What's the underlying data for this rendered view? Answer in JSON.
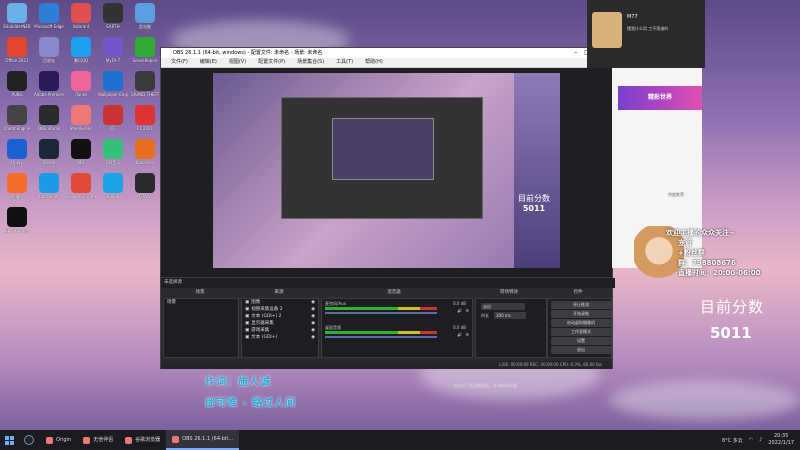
{
  "desktop": {
    "icons": [
      {
        "label": "EdubilderNEB",
        "color": "#6ab0e8"
      },
      {
        "label": "Microsoft Edge",
        "color": "#2f7fd8"
      },
      {
        "label": "Valorant",
        "color": "#e05050"
      },
      {
        "label": "EARTH",
        "color": "#333"
      },
      {
        "label": "此电脑",
        "color": "#5aa0e0"
      },
      {
        "label": "Office 2021",
        "color": "#e4452f"
      },
      {
        "label": "回收站",
        "color": "#88c"
      },
      {
        "label": "腾讯QQ",
        "color": "#1ea0f0"
      },
      {
        "label": "MyFA-7",
        "color": "#7755cc"
      },
      {
        "label": "SenseRepair",
        "color": "#3a3"
      },
      {
        "label": "PUBG",
        "color": "#222"
      },
      {
        "label": "Adobe Premiere",
        "color": "#2a1a55"
      },
      {
        "label": "iTunes",
        "color": "#ee6699"
      },
      {
        "label": "Wallpaper Engine",
        "color": "#2070d0"
      },
      {
        "label": "GRAND THEFT",
        "color": "#3a3a3a"
      },
      {
        "label": "Cheat Engine",
        "color": "#444"
      },
      {
        "label": "OBS Studio",
        "color": "#2b2b2b"
      },
      {
        "label": "SteelSeries",
        "color": "#e77"
      },
      {
        "label": "CF",
        "color": "#c33"
      },
      {
        "label": "F1 2021",
        "color": "#d33"
      },
      {
        "label": "Uplay",
        "color": "#1a60d0"
      },
      {
        "label": "Steam",
        "color": "#1b2838"
      },
      {
        "label": "M2",
        "color": "#111"
      },
      {
        "label": "QQ音乐",
        "color": "#33c17a"
      },
      {
        "label": "Kuaishou",
        "color": "#e86f20"
      },
      {
        "label": "Origin",
        "color": "#f56c2d"
      },
      {
        "label": "Battle.net",
        "color": "#1a9be8"
      },
      {
        "label": "Google Chrome",
        "color": "#de4a36"
      },
      {
        "label": "BiliBili",
        "color": "#1aa3e8"
      },
      {
        "label": "GTA V",
        "color": "#2a2a2a"
      },
      {
        "label": "Epic Games",
        "color": "#111"
      }
    ]
  },
  "obs": {
    "title": "OBS 26.1.1 (64-bit, windows) - 配置文件: 未命名 - 场景: 未命名",
    "menu": [
      "文件(F)",
      "编辑(E)",
      "视图(V)",
      "配置文件(P)",
      "场景集合(S)",
      "工具(T)",
      "帮助(H)"
    ],
    "dockbar_label": "未选择源",
    "docks": {
      "scenes": {
        "title": "场景",
        "items": [
          "场景"
        ]
      },
      "sources": {
        "title": "来源",
        "items": [
          "图像",
          "视频采集设备 2",
          "文本 (GDI+) 2",
          "显示器采集",
          "游戏采集",
          "文本 (GDI+)"
        ]
      },
      "mixer": {
        "title": "混音器",
        "channels": [
          {
            "name": "麦克风/Aux",
            "db": "0.0 dB"
          },
          {
            "name": "桌面音频",
            "db": "0.0 dB"
          }
        ]
      },
      "transitions": {
        "title": "转场特效",
        "type": "淡出",
        "duration_label": "时长",
        "duration": "300 ms"
      },
      "controls": {
        "title": "控件",
        "buttons": [
          "停止推流",
          "开始录制",
          "启动虚拟摄像机",
          "工作室模式",
          "设置",
          "退出"
        ]
      }
    },
    "status": "LIVE: 00:00:00   REC: 00:00:00   CPU: 6.0%, 60.00 fps"
  },
  "lyrics": {
    "line1": "作词：施人诚",
    "line2": "邰可唯 - 路过人间"
  },
  "chat": {
    "name": "M77",
    "message": "懂我什么用 工不落谱的"
  },
  "app_panel": {
    "banner": "精彩世界",
    "side_label": "热度推荐"
  },
  "overlay": {
    "welcome": "欢迎主播的众众关注~",
    "nickname": "宠管",
    "fans_group": "+粉丝群",
    "group_number": "群：798808676",
    "time": "直播时间：20:00-06:00",
    "score_label": "目前分数",
    "score_value": "5011"
  },
  "mini_text": "点击右下角设置按钮，开始你的直播",
  "taskbar": {
    "apps": [
      {
        "label": "Origin",
        "active": false
      },
      {
        "label": "无他伴侣",
        "active": false
      },
      {
        "label": "谷歌浏览器",
        "active": false
      },
      {
        "label": "OBS 26.1.1 (64-bit...",
        "active": true
      }
    ],
    "weather": "8°C 多云",
    "time": "20:35",
    "date": "2022/1/17"
  }
}
